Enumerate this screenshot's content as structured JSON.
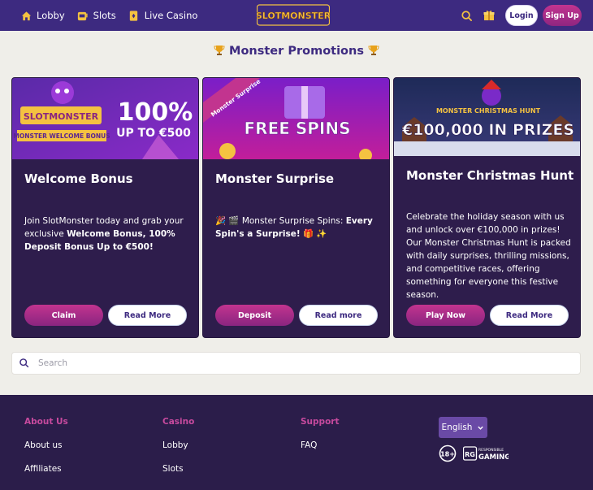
{
  "header": {
    "nav": [
      {
        "label": "Lobby",
        "icon": "home-icon"
      },
      {
        "label": "Slots",
        "icon": "slot-machine-icon"
      },
      {
        "label": "Live Casino",
        "icon": "cards-icon"
      }
    ],
    "logo_text": "SLOTMONSTER",
    "login_label": "Login",
    "signup_label": "Sign Up"
  },
  "page": {
    "title": "Monster Promotions"
  },
  "cards": [
    {
      "banner_text_1": "100%",
      "banner_text_2": "UP TO €500",
      "banner_logo": "SLOTMONSTER",
      "banner_ribbon": "MONSTER WELCOME BONUS",
      "title": "Welcome Bonus",
      "desc_plain": "Join SlotMonster today and grab your exclusive ",
      "desc_bold": "Welcome Bonus, 100% Deposit Bonus Up to €500!",
      "primary_label": "Claim",
      "secondary_label": "Read More"
    },
    {
      "banner_ribbon": "Monster Surprise",
      "banner_text_1": "FREE SPINS",
      "title": "Monster Surprise",
      "desc_plain": "🎉 🎬 Monster Surprise Spins: ",
      "desc_bold": "Every Spin's a Surprise!",
      "desc_end": " 🎁 ✨",
      "primary_label": "Deposit",
      "secondary_label": "Read more"
    },
    {
      "banner_text_small": "MONSTER CHRISTMAS HUNT",
      "banner_text_1": "€100,000 IN PRIZES",
      "title": "Monster Christmas Hunt",
      "desc": "Celebrate the holiday season with us and unlock over €100,000 in prizes! Our Monster Christmas Hunt is packed with daily surprises, thrilling missions, and competitive races, offering something for everyone this festive season.",
      "primary_label": "Play Now",
      "secondary_label": "Read More"
    }
  ],
  "search": {
    "placeholder": "Search"
  },
  "footer": {
    "columns": [
      {
        "heading": "About Us",
        "links": [
          "About us",
          "Affiliates"
        ]
      },
      {
        "heading": "Casino",
        "links": [
          "Lobby",
          "Slots"
        ]
      },
      {
        "heading": "Support",
        "links": [
          "FAQ"
        ]
      }
    ],
    "language": "English",
    "age_badge": "18+",
    "rg_text_top": "RESPONSIBLE",
    "rg_text_bottom": "GAMING",
    "rg_logo": "RG"
  },
  "colors": {
    "header_bg": "#3d2a80",
    "page_bg": "#efeee9",
    "card_bg": "#2e1d4c",
    "accent_pink": "#c2348f",
    "footer_bg": "#2b1d4a"
  }
}
